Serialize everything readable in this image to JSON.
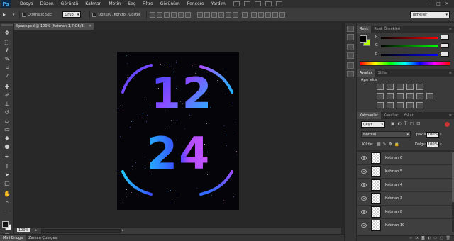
{
  "app": {
    "logo": "Ps"
  },
  "menu": [
    "Dosya",
    "Düzen",
    "Görüntü",
    "Katman",
    "Metin",
    "Seç",
    "Filtre",
    "Görünüm",
    "Pencere",
    "Yardım"
  ],
  "options": {
    "auto_select_label": "Otomatik Seç:",
    "auto_select_value": "Grup",
    "transform_label": "Dönüşü. Kontrol. Göster",
    "workspace": "Temeller"
  },
  "document": {
    "tab_title": "Space.psd @ 100% (Katman 1, RGB/8)",
    "zoom": "100%"
  },
  "bottom_tabs": [
    "Mini Bridge",
    "Zaman Çizelgesi"
  ],
  "color_panel": {
    "tabs": [
      "Renk",
      "Renk Örnekleri"
    ],
    "channels": [
      "R",
      "G",
      "B"
    ]
  },
  "adjustments": {
    "tabs": [
      "Ayarlar",
      "Stiller"
    ],
    "heading": "Ayar ekle"
  },
  "layers_panel": {
    "tabs": [
      "Katmanlar",
      "Kanallar",
      "Yollar"
    ],
    "filter": "Çeşit",
    "blend_mode": "Normal",
    "opacity_label": "Opaklık:",
    "opacity": "100%",
    "lock_label": "Kilitle:",
    "fill_label": "Dolgu:",
    "fill": "100%",
    "layers": [
      "Katman 6",
      "Katman 5",
      "Katman 4",
      "Katman 3",
      "Katman 8",
      "Katman 10"
    ]
  },
  "artwork": {
    "line1": "12",
    "line2": "24"
  },
  "colors": {
    "accent_blue": "#3a5cff",
    "accent_violet": "#a04cff",
    "accent_cyan": "#25b4ff"
  }
}
